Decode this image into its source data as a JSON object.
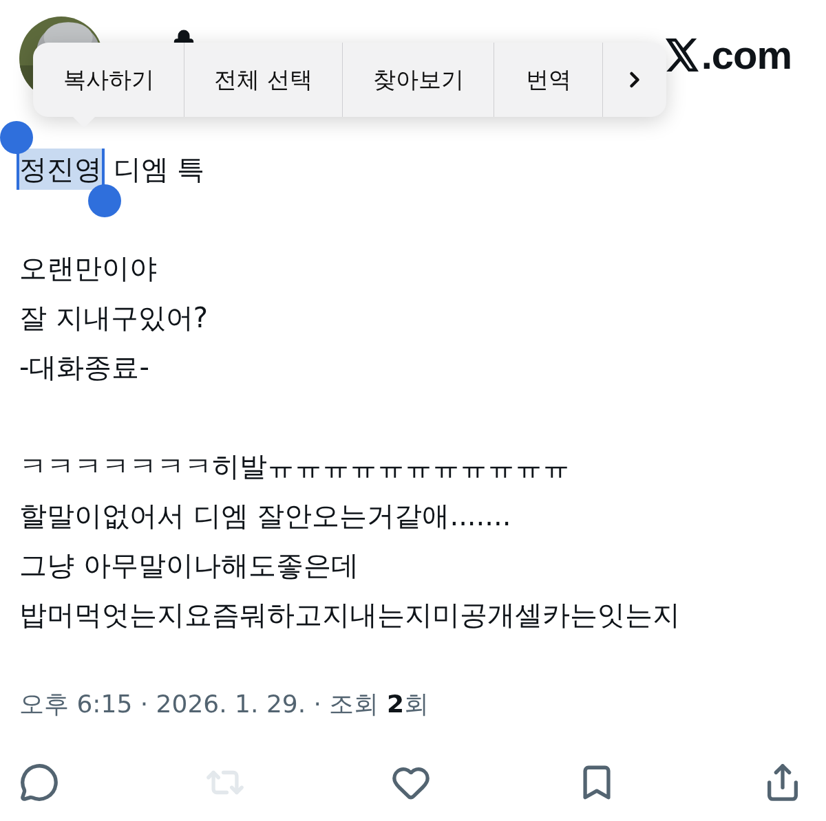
{
  "header": {
    "locked": true,
    "brand": ".com"
  },
  "context_menu": {
    "items": [
      "복사하기",
      "전체 선택",
      "찾아보기",
      "번역"
    ],
    "more": true
  },
  "post": {
    "paragraphs": [
      {
        "lines": [
          [
            {
              "text": "정진영",
              "selected": true
            },
            {
              "text": " 디엠 특",
              "selected": false
            }
          ]
        ]
      },
      {
        "lines": [
          [
            {
              "text": "오랜만이야",
              "selected": false
            }
          ],
          [
            {
              "text": "잘 지내구있어?",
              "selected": false
            }
          ],
          [
            {
              "text": "-대화종료-",
              "selected": false
            }
          ]
        ]
      },
      {
        "lines": [
          [
            {
              "text": "ㅋㅋㅋㅋㅋㅋㅋ히발ㅠㅠㅠㅠㅠㅠㅠㅠㅠㅠㅠ",
              "selected": false
            }
          ],
          [
            {
              "text": "할말이없어서 디엠 잘안오는거같애.......",
              "selected": false
            }
          ],
          [
            {
              "text": "그냥 아무말이나해도좋은데",
              "selected": false
            }
          ],
          [
            {
              "text": "밥머먹엇는지요즘뭐하고지내는지미공개셀카는잇는지",
              "selected": false
            }
          ]
        ]
      }
    ],
    "meta": "오후 6:15 · 2026. 1. 29. · 조회 **2**회"
  },
  "actions": [
    {
      "kind": "reply",
      "disabled": false
    },
    {
      "kind": "repost",
      "disabled": true
    },
    {
      "kind": "like",
      "disabled": false
    },
    {
      "kind": "bookmark",
      "disabled": false
    },
    {
      "kind": "share",
      "disabled": false
    }
  ]
}
